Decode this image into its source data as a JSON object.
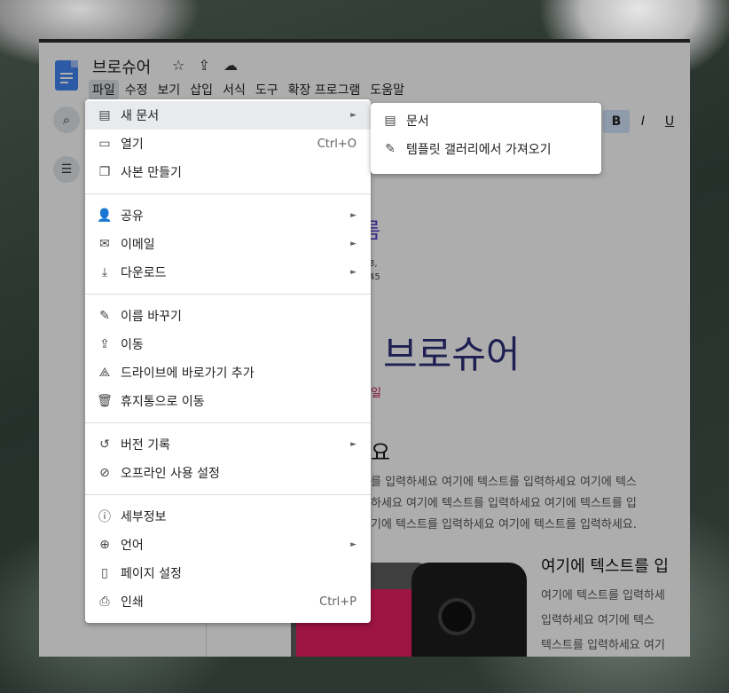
{
  "document": {
    "title": "브로슈어",
    "heading_partial": "름",
    "address_lines": [
      "3,",
      "45"
    ],
    "big_name_partial": "브로슈어",
    "date_partial": "일",
    "heading2_partial": "요",
    "paragraph_lines": [
      "를 입력하세요 여기에 텍스트를 입력하세요 여기에 텍스",
      "하세요 여기에 텍스트를 입력하세요 여기에 텍스트를 입",
      "기에 텍스트를 입력하세요 여기에 텍스트를 입력하세요."
    ],
    "heading3_partial": "여기에 텍스트를 입",
    "paragraph2_lines": [
      "여기에 텍스트를 입력하세",
      "입력하세요 여기에 텍스",
      "텍스트를 입력하세요 여기"
    ]
  },
  "title_icons": {
    "star": "☆",
    "move": "⇪",
    "cloud": "☁"
  },
  "menubar": [
    "파일",
    "수정",
    "보기",
    "삽입",
    "서식",
    "도구",
    "확장 프로그램",
    "도움말"
  ],
  "toolbar": {
    "bold": "B",
    "italic": "I",
    "underline": "U"
  },
  "file_menu": {
    "groups": [
      [
        {
          "icon": "new-doc-icon",
          "glyph": "▤",
          "label": "새 문서",
          "arrow": "►"
        },
        {
          "icon": "folder-open-icon",
          "glyph": "▭",
          "label": "열기",
          "shortcut": "Ctrl+O"
        },
        {
          "icon": "copy-icon",
          "glyph": "❐",
          "label": "사본 만들기"
        }
      ],
      [
        {
          "icon": "share-person-icon",
          "glyph": "👤",
          "label": "공유",
          "arrow": "►"
        },
        {
          "icon": "mail-icon",
          "glyph": "✉",
          "label": "이메일",
          "arrow": "►"
        },
        {
          "icon": "download-icon",
          "glyph": "⤓",
          "label": "다운로드",
          "arrow": "►"
        }
      ],
      [
        {
          "icon": "rename-icon",
          "glyph": "✎",
          "label": "이름 바꾸기"
        },
        {
          "icon": "move-folder-icon",
          "glyph": "⇪",
          "label": "이동"
        },
        {
          "icon": "drive-shortcut-icon",
          "glyph": "⟁",
          "label": "드라이브에 바로가기 추가"
        },
        {
          "icon": "trash-icon",
          "glyph": "🗑",
          "label": "휴지통으로 이동"
        }
      ],
      [
        {
          "icon": "history-icon",
          "glyph": "↺",
          "label": "버전 기록",
          "arrow": "►"
        },
        {
          "icon": "offline-icon",
          "glyph": "⊘",
          "label": "오프라인 사용 설정"
        }
      ],
      [
        {
          "icon": "info-icon",
          "glyph": "ⓘ",
          "label": "세부정보"
        },
        {
          "icon": "globe-icon",
          "glyph": "⊕",
          "label": "언어",
          "arrow": "►"
        },
        {
          "icon": "page-setup-icon",
          "glyph": "▯",
          "label": "페이지 설정"
        },
        {
          "icon": "print-icon",
          "glyph": "⎙",
          "label": "인쇄",
          "shortcut": "Ctrl+P"
        }
      ]
    ]
  },
  "new_submenu": [
    {
      "icon": "docs-icon",
      "glyph": "▤",
      "label": "문서"
    },
    {
      "icon": "template-icon",
      "glyph": "✎",
      "label": "템플릿 갤러리에서 가져오기"
    }
  ],
  "colors": {
    "docs_blue": "#4285f4",
    "heading_purple": "#5b3fd1",
    "date_pink": "#c2185b"
  }
}
